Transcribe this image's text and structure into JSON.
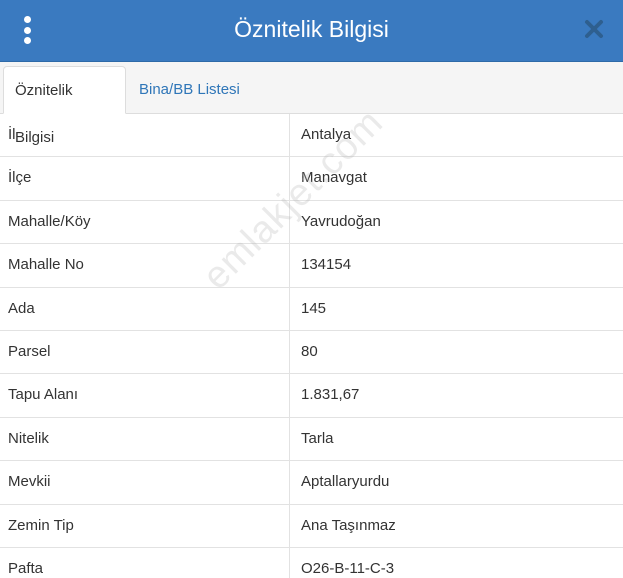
{
  "header": {
    "title": "Öznitelik Bilgisi"
  },
  "tabs": [
    {
      "label": "Öznitelik Bilgisi",
      "active": true
    },
    {
      "label": "Bina/BB Listesi",
      "active": false
    }
  ],
  "rows": [
    {
      "key": "İl",
      "value": "Antalya"
    },
    {
      "key": "İlçe",
      "value": "Manavgat"
    },
    {
      "key": "Mahalle/Köy",
      "value": "Yavrudoğan"
    },
    {
      "key": "Mahalle No",
      "value": "134154"
    },
    {
      "key": "Ada",
      "value": "145"
    },
    {
      "key": "Parsel",
      "value": "80"
    },
    {
      "key": "Tapu Alanı",
      "value": "1.831,67"
    },
    {
      "key": "Nitelik",
      "value": "Tarla"
    },
    {
      "key": "Mevkii",
      "value": "Aptallaryurdu"
    },
    {
      "key": "Zemin Tip",
      "value": "Ana Taşınmaz"
    },
    {
      "key": "Pafta",
      "value": "O26-B-11-C-3"
    }
  ],
  "watermark": "emlakjet.com",
  "icons": {
    "menu": "kebab-menu-icon",
    "close": "close-icon"
  },
  "colors": {
    "header_bg": "#3a7ac0",
    "tab_link": "#2f76b8",
    "close_icon": "#2e5f8f"
  }
}
